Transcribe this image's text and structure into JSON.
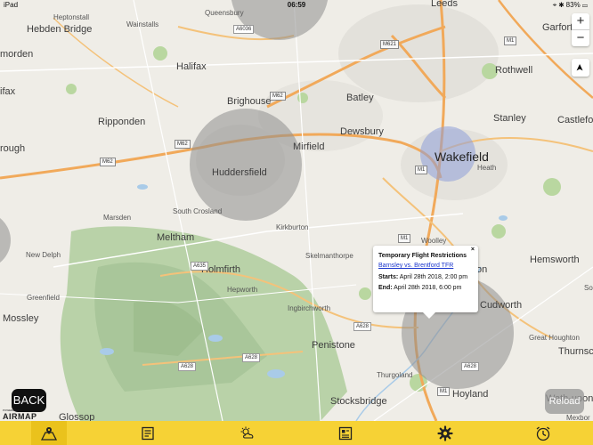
{
  "status_bar": {
    "left": "iPad",
    "time": "06:59",
    "battery": "83%"
  },
  "map_controls": {
    "zoom_in": "+",
    "zoom_out": "−",
    "locate": "➤"
  },
  "places": [
    {
      "name": "Leeds",
      "cls": "city"
    },
    {
      "name": "Hebden Bridge",
      "cls": "city"
    },
    {
      "name": "Heptonstall",
      "cls": "town"
    },
    {
      "name": "Wainstalls",
      "cls": "town"
    },
    {
      "name": "Queensbury",
      "cls": "town"
    },
    {
      "name": "Garforth",
      "cls": "city"
    },
    {
      "name": "Halifax",
      "cls": "city"
    },
    {
      "name": "Rothwell",
      "cls": "city"
    },
    {
      "name": "Brighouse",
      "cls": "city"
    },
    {
      "name": "Batley",
      "cls": "city"
    },
    {
      "name": "Ripponden",
      "cls": "city"
    },
    {
      "name": "Stanley",
      "cls": "city"
    },
    {
      "name": "Castleford",
      "cls": "city"
    },
    {
      "name": "Mirfield",
      "cls": "city"
    },
    {
      "name": "Dewsbury",
      "cls": "city"
    },
    {
      "name": "Huddersfield",
      "cls": "city"
    },
    {
      "name": "Wakefield",
      "cls": "big"
    },
    {
      "name": "Heath",
      "cls": "town"
    },
    {
      "name": "Marsden",
      "cls": "town"
    },
    {
      "name": "South Crosland",
      "cls": "town"
    },
    {
      "name": "Kirkburton",
      "cls": "town"
    },
    {
      "name": "Meltham",
      "cls": "city"
    },
    {
      "name": "Woolley",
      "cls": "town"
    },
    {
      "name": "New Delph",
      "cls": "town"
    },
    {
      "name": "Skelmanthorpe",
      "cls": "town"
    },
    {
      "name": "Holmfirth",
      "cls": "city"
    },
    {
      "name": "Hemsworth",
      "cls": "city"
    },
    {
      "name": "Greenfield",
      "cls": "town"
    },
    {
      "name": "Hepworth",
      "cls": "town"
    },
    {
      "name": "Mossley",
      "cls": "city"
    },
    {
      "name": "Ingbirchworth",
      "cls": "town"
    },
    {
      "name": "Cudworth",
      "cls": "city"
    },
    {
      "name": "Penistone",
      "cls": "city"
    },
    {
      "name": "Great Houghton",
      "cls": "town"
    },
    {
      "name": "Thurnsco",
      "cls": "city"
    },
    {
      "name": "Thurgoland",
      "cls": "town"
    },
    {
      "name": "Stocksbridge",
      "cls": "city"
    },
    {
      "name": "Hoyland",
      "cls": "city"
    },
    {
      "name": "Wath-upon-Dearne",
      "cls": "city"
    },
    {
      "name": "Glossop",
      "cls": "city"
    },
    {
      "name": "Mexbor",
      "cls": "town"
    },
    {
      "name": "rough",
      "cls": "city"
    },
    {
      "name": "morden",
      "cls": "city"
    },
    {
      "name": "ifax",
      "cls": "city"
    },
    {
      "name": "ton",
      "cls": "city"
    },
    {
      "name": "So",
      "cls": "town"
    }
  ],
  "roads": [
    "A6036",
    "M621",
    "M1",
    "M62",
    "M62",
    "M62",
    "M1",
    "M1",
    "A635",
    "A628",
    "A628",
    "A628",
    "A628",
    "M1"
  ],
  "popup": {
    "title": "Temporary Flight Restrictions",
    "link": "Barnsley vs. Brentford TFR",
    "starts_label": "Starts:",
    "starts_value": "April 28th 2018, 2:00 pm",
    "end_label": "End:",
    "end_value": "April 28th 2018, 6:00 pm",
    "close": "×"
  },
  "back_label": "BACK",
  "brand": {
    "powered": "POWERED BY",
    "name": "AIRMAP"
  },
  "reload_label": "Reload",
  "tabs": [
    {
      "icon": "map-icon",
      "active": true
    },
    {
      "icon": "checklist-icon",
      "active": false
    },
    {
      "icon": "weather-icon",
      "active": false
    },
    {
      "icon": "notes-icon",
      "active": false
    },
    {
      "icon": "settings-icon",
      "active": false
    },
    {
      "icon": "timer-icon",
      "active": false
    }
  ],
  "colors": {
    "tab_bar": "#f6d235",
    "tfr_circle": "#8e8e8e",
    "airport_circle": "#8e9fd8",
    "popup_link": "#1a35cc"
  }
}
